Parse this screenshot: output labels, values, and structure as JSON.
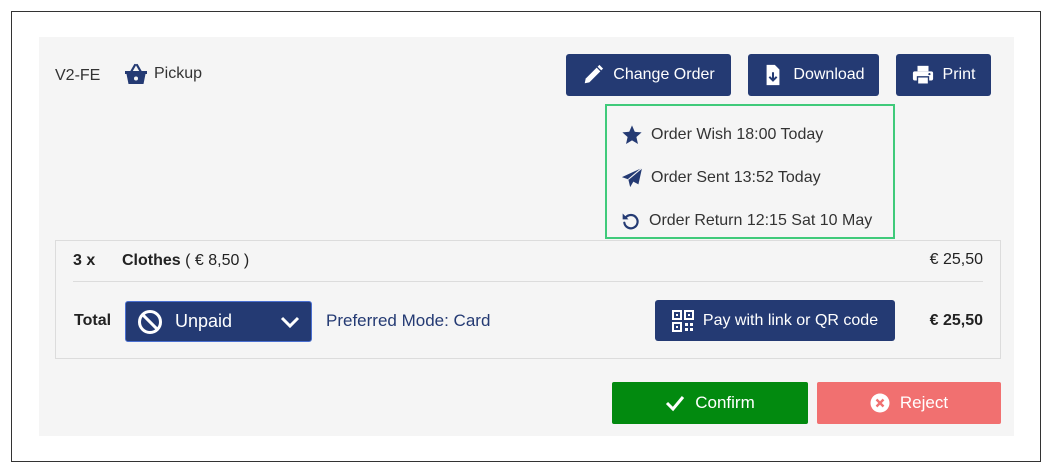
{
  "header": {
    "order_id": "V2-FE",
    "mode_icon": "shopping-basket-icon",
    "mode_label": "Pickup"
  },
  "actions": {
    "change_order_label": "Change Order",
    "download_label": "Download",
    "print_label": "Print"
  },
  "times": [
    {
      "icon": "star-icon",
      "label": "Order Wish 18:00 Today"
    },
    {
      "icon": "paper-plane-icon",
      "label": "Order Sent 13:52 Today"
    },
    {
      "icon": "undo-icon",
      "label": "Order Return 12:15 Sat 10 May"
    }
  ],
  "items": [
    {
      "qty": "3 x",
      "name": "Clothes",
      "unit_price": "( € 8,50 )",
      "price": "€ 25,50"
    }
  ],
  "totals": {
    "label": "Total",
    "payment_status": "Unpaid",
    "preferred_mode": "Preferred Mode: Card",
    "pay_button_label": "Pay with link or QR code",
    "amount": "€ 25,50"
  },
  "footer": {
    "confirm_label": "Confirm",
    "reject_label": "Reject"
  },
  "colors": {
    "primary": "#243a73",
    "confirm": "#028a0f",
    "reject": "#f17070",
    "highlight_border": "#3fca7a",
    "panel_bg": "#f5f5f5"
  }
}
